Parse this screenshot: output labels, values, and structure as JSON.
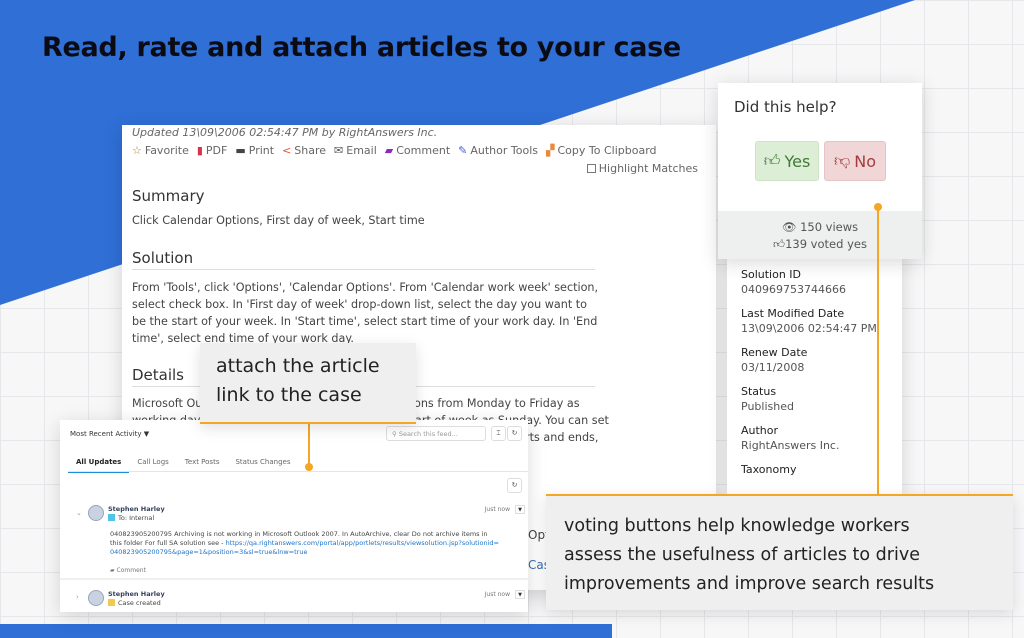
{
  "headline": "Read, rate and attach articles to your case",
  "colors": {
    "brand_blue": "#2f6fd6",
    "accent_orange": "#f5a623",
    "yes_green": "#3f7a35",
    "no_red": "#a33d3d"
  },
  "article": {
    "updated": "Updated 13\\09\\2006 02:54:47 PM by RightAnswers Inc.",
    "tools": [
      {
        "icon": "star-icon",
        "glyph": "☆",
        "color": "#b0803a",
        "label": "Favorite"
      },
      {
        "icon": "pdf-icon",
        "glyph": "▮",
        "color": "#d9334b",
        "label": "PDF"
      },
      {
        "icon": "print-icon",
        "glyph": "▬",
        "color": "#444",
        "label": "Print"
      },
      {
        "icon": "share-icon",
        "glyph": "<",
        "color": "#e2562c",
        "label": "Share"
      },
      {
        "icon": "email-icon",
        "glyph": "✉",
        "color": "#555",
        "label": "Email"
      },
      {
        "icon": "comment-icon",
        "glyph": "▰",
        "color": "#8a2bbd",
        "label": "Comment"
      },
      {
        "icon": "edit-icon",
        "glyph": "✎",
        "color": "#4a5fc7",
        "label": "Author Tools"
      },
      {
        "icon": "clipboard-icon",
        "glyph": "▞",
        "color": "#e88a3a",
        "label": "Copy To Clipboard"
      }
    ],
    "highlight_label": "Highlight Matches",
    "summary_title": "Summary",
    "summary_text": "Click Calendar Options, First day of week, Start time",
    "solution_title": "Solution",
    "solution_text": "From 'Tools', click 'Options', 'Calendar Options'. From 'Calendar work week' section, select check box. In 'First day of week' drop-down list, select the day you want to be the start of your week. In 'Start time', select start time of your work day. In 'End time', select end time of your work day.",
    "details_title": "Details",
    "details_fragments": [
      "Microsoft Outl",
      "ons from Monday to Friday as",
      "working days.",
      "art of week as Sunday. You can set",
      "rts and ends,",
      "Opt",
      "Cas"
    ]
  },
  "vote": {
    "question": "Did this help?",
    "yes": "Yes",
    "no": "No",
    "views": "150 views",
    "voted_yes": "139 voted yes"
  },
  "meta": [
    {
      "label": "Solution ID",
      "value": "040969753744666"
    },
    {
      "label": "Last Modified Date",
      "value": "13\\09\\2006 02:54:47 PM"
    },
    {
      "label": "Renew Date",
      "value": "03/11/2008"
    },
    {
      "label": "Status",
      "value": "Published"
    },
    {
      "label": "Author",
      "value": "RightAnswers Inc."
    },
    {
      "label": "Taxonomy",
      "value": ""
    }
  ],
  "callouts": {
    "attach": [
      "attach the article",
      "link to the case"
    ],
    "voting": [
      "voting buttons help knowledge workers",
      "assess the usefulness of articles to drive",
      "improvements and improve search results"
    ]
  },
  "feed": {
    "filter": "Most Recent Activity",
    "search_placeholder": "Search this feed...",
    "tabs": [
      "All Updates",
      "Call Logs",
      "Text Posts",
      "Status Changes"
    ],
    "posts": [
      {
        "author": "Stephen Harley",
        "sub": "To: Internal",
        "sub_color": "#4fc3e8",
        "time": "Just now",
        "text": "040823905200795 Archiving is not working in Microsoft Outlook 2007. In AutoArchive, clear Do not archive items in this folder For full SA solution see - ",
        "link": "https://qa.rightanswers.com/portal/app/portlets/results/viewsolution.jsp?solutionid=040823905200795&page=1&position=3&sl=true&lnw=true",
        "comment": "Comment"
      },
      {
        "author": "Stephen Harley",
        "sub": "Case created",
        "sub_color": "#f2c94c",
        "time": "Just now"
      }
    ]
  }
}
